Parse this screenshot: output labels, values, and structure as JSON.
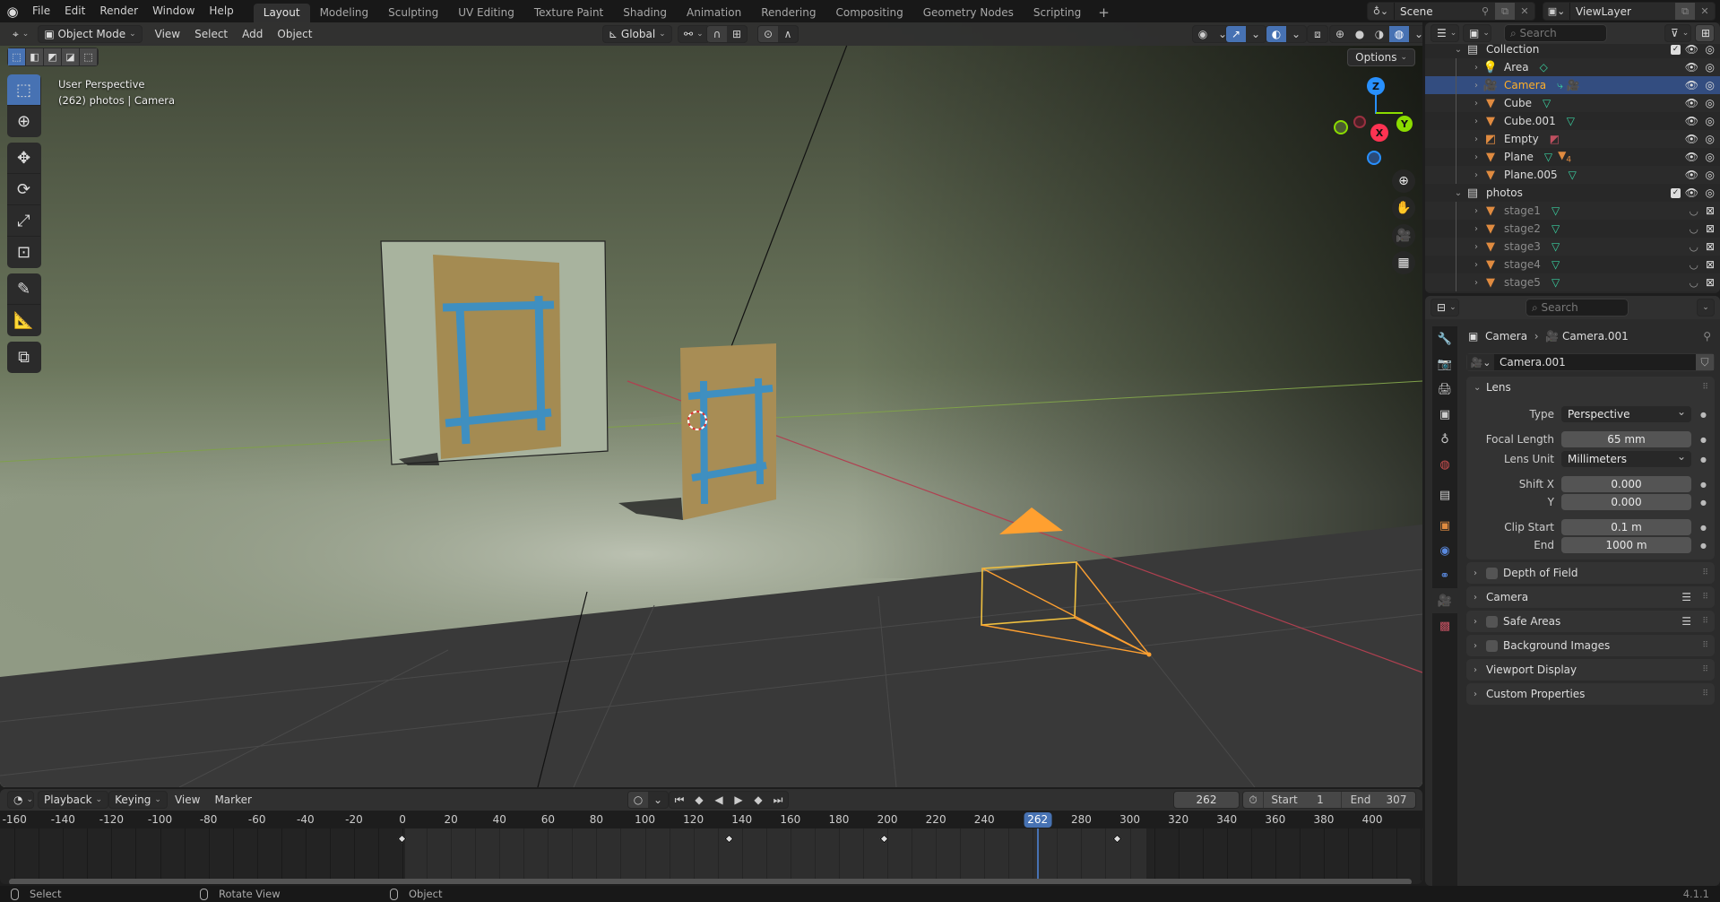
{
  "app": {
    "logo_icon": "blender-logo-icon",
    "version": "4.1.1"
  },
  "menus": [
    "File",
    "Edit",
    "Render",
    "Window",
    "Help"
  ],
  "workspaces": [
    {
      "label": "Layout",
      "active": true
    },
    {
      "label": "Modeling"
    },
    {
      "label": "Sculpting"
    },
    {
      "label": "UV Editing"
    },
    {
      "label": "Texture Paint"
    },
    {
      "label": "Shading"
    },
    {
      "label": "Animation"
    },
    {
      "label": "Rendering"
    },
    {
      "label": "Compositing"
    },
    {
      "label": "Geometry Nodes"
    },
    {
      "label": "Scripting"
    }
  ],
  "scene": {
    "label": "Scene",
    "view_layer": "ViewLayer"
  },
  "viewport": {
    "mode": "Object Mode",
    "menus": [
      "View",
      "Select",
      "Add",
      "Object"
    ],
    "transform_orientation": "Global",
    "options_label": "Options",
    "info_line1": "User Perspective",
    "info_line2": "(262) photos | Camera",
    "gizmo_axes": {
      "z": "Z",
      "x": "X",
      "y": "Y"
    },
    "colors": {
      "x_axis": "#ff3352",
      "y_axis": "#8bdc00",
      "z_axis": "#2890ff",
      "selected": "#ffa030",
      "active_blue": "#4772b3"
    }
  },
  "outliner": {
    "search_placeholder": "Search",
    "rows": [
      {
        "label": "Collection",
        "type": "collection",
        "depth": 0,
        "expanded": true
      },
      {
        "label": "Area",
        "type": "light",
        "depth": 1
      },
      {
        "label": "Camera",
        "type": "camera",
        "depth": 1,
        "selected": true
      },
      {
        "label": "Cube",
        "type": "mesh",
        "depth": 1
      },
      {
        "label": "Cube.001",
        "type": "mesh",
        "depth": 1
      },
      {
        "label": "Empty",
        "type": "empty-image",
        "depth": 1
      },
      {
        "label": "Plane",
        "type": "mesh",
        "depth": 1,
        "modifier_count": "4"
      },
      {
        "label": "Plane.005",
        "type": "mesh",
        "depth": 1
      },
      {
        "label": "photos",
        "type": "collection",
        "depth": 0,
        "expanded": true
      },
      {
        "label": "stage1",
        "type": "mesh",
        "depth": 1,
        "hidden": true
      },
      {
        "label": "stage2",
        "type": "mesh",
        "depth": 1,
        "hidden": true
      },
      {
        "label": "stage3",
        "type": "mesh",
        "depth": 1,
        "hidden": true
      },
      {
        "label": "stage4",
        "type": "mesh",
        "depth": 1,
        "hidden": true
      },
      {
        "label": "stage5",
        "type": "mesh",
        "depth": 1,
        "hidden": true
      }
    ]
  },
  "properties": {
    "search_placeholder": "Search",
    "breadcrumb": {
      "object": "Camera",
      "data": "Camera.001"
    },
    "datablock_name": "Camera.001",
    "lens_panel": {
      "title": "Lens",
      "type_label": "Type",
      "type_value": "Perspective",
      "focal_label": "Focal Length",
      "focal_value": "65 mm",
      "unit_label": "Lens Unit",
      "unit_value": "Millimeters",
      "shiftx_label": "Shift X",
      "shiftx_value": "0.000",
      "shifty_label": "Y",
      "shifty_value": "0.000",
      "clipstart_label": "Clip Start",
      "clipstart_value": "0.1 m",
      "clipend_label": "End",
      "clipend_value": "1000 m"
    },
    "collapsed_panels": [
      {
        "label": "Depth of Field",
        "checkbox": true
      },
      {
        "label": "Camera",
        "presets": true
      },
      {
        "label": "Safe Areas",
        "checkbox": true,
        "presets": true
      },
      {
        "label": "Background Images",
        "checkbox": true
      },
      {
        "label": "Viewport Display"
      },
      {
        "label": "Custom Properties"
      }
    ]
  },
  "timeline": {
    "menus": [
      "Playback",
      "Keying",
      "View",
      "Marker"
    ],
    "current_frame": "262",
    "start_label": "Start",
    "start_value": "1",
    "end_label": "End",
    "end_value": "307",
    "ruler_ticks": [
      "-160",
      "-140",
      "-120",
      "-100",
      "-80",
      "-60",
      "-40",
      "-20",
      "0",
      "20",
      "40",
      "60",
      "80",
      "100",
      "120",
      "140",
      "160",
      "180",
      "200",
      "220",
      "240",
      "262",
      "280",
      "300",
      "320",
      "340",
      "360",
      "380",
      "400"
    ],
    "keyframes": [
      0,
      135,
      199,
      295
    ],
    "frame_range": [
      1,
      307
    ]
  },
  "statusbar": {
    "left": "Select",
    "middle": "Rotate View",
    "right": "Object"
  }
}
